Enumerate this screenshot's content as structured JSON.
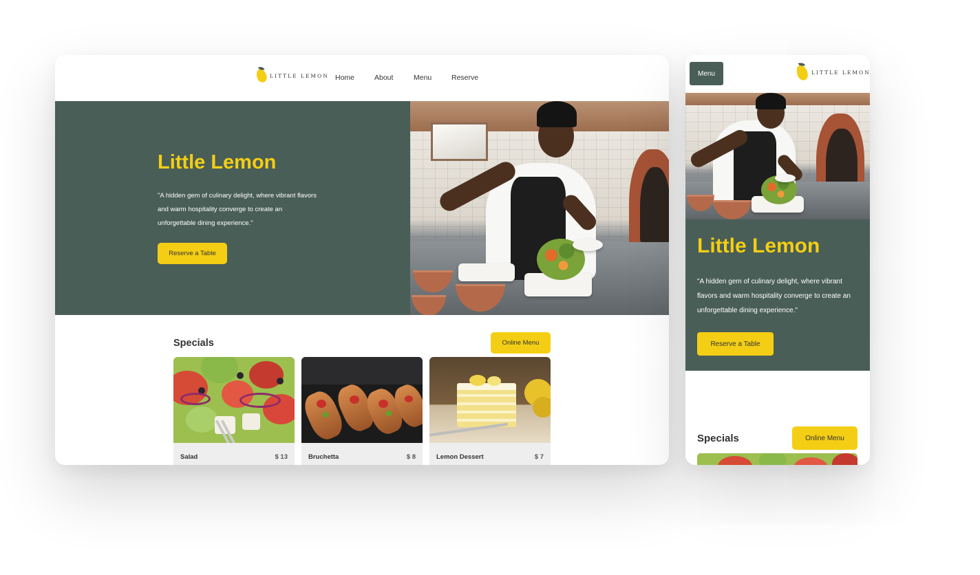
{
  "brand": {
    "name": "LITTLE LEMON",
    "primary": "#495e57",
    "accent": "#f4ce14",
    "text": "#333333"
  },
  "desktop": {
    "nav": {
      "links": [
        "Home",
        "About",
        "Menu",
        "Reserve"
      ]
    },
    "hero": {
      "title": "Little Lemon",
      "description": "\"A hidden gem of culinary delight, where vibrant flavors and warm hospitality converge to create an unforgettable dining experience.\"",
      "button": "Reserve a Table",
      "photo_icon": "chef-plating-salad-photo"
    },
    "specials": {
      "title": "Specials",
      "button": "Online Menu",
      "items": [
        {
          "name": "Salad",
          "price": "$ 13",
          "image_icon": "greek-salad-photo"
        },
        {
          "name": "Bruchetta",
          "price": "$ 8",
          "image_icon": "bruschetta-photo"
        },
        {
          "name": "Lemon Dessert",
          "price": "$ 7",
          "image_icon": "lemon-cake-photo"
        }
      ]
    }
  },
  "mobile": {
    "menu_button": "Menu",
    "hero": {
      "title": "Little Lemon",
      "description": "\"A hidden gem of culinary delight, where vibrant flavors and warm hospitality converge to create an unforgettable dining experience.\"",
      "button": "Reserve a Table"
    },
    "specials": {
      "title": "Specials",
      "button": "Online Menu"
    }
  }
}
